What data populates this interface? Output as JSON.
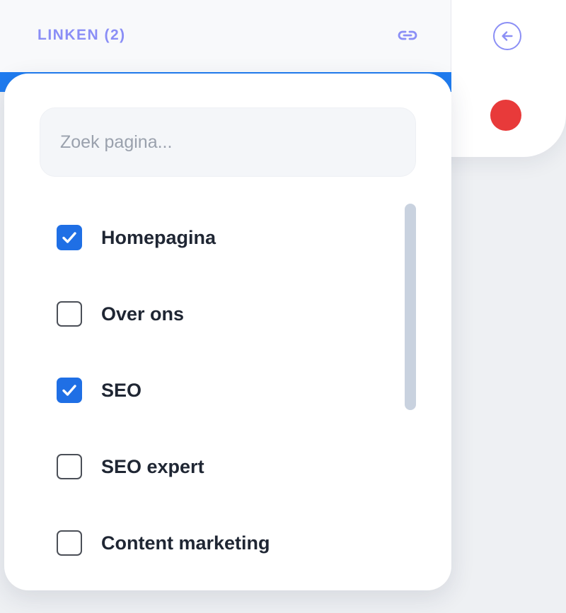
{
  "header": {
    "title": "LINKEN (2)",
    "link_icon": "link-icon"
  },
  "rail": {
    "back_icon": "arrow-left-circle-icon",
    "status_color": "#e83a3a"
  },
  "search": {
    "placeholder": "Zoek pagina...",
    "value": ""
  },
  "pages": [
    {
      "label": "Homepagina",
      "checked": true
    },
    {
      "label": "Over ons",
      "checked": false
    },
    {
      "label": "SEO",
      "checked": true
    },
    {
      "label": "SEO expert",
      "checked": false
    },
    {
      "label": "Content marketing",
      "checked": false
    }
  ],
  "colors": {
    "accent": "#8a8ef6",
    "checkbox_checked": "#1f6fe5"
  }
}
